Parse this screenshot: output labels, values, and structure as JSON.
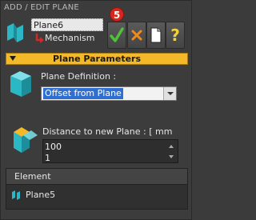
{
  "window": {
    "title": "ADD / EDIT PLANE"
  },
  "tree": {
    "selected_item": "Plane6",
    "child_item": "Mechanism"
  },
  "toolbar": {
    "badge": "5",
    "help_label": "?"
  },
  "section": {
    "title": "Plane Parameters"
  },
  "definition": {
    "label": "Plane Definition :",
    "selected_value": "Offset from Plane"
  },
  "distance": {
    "label": "Distance to new Plane : [ mm",
    "value_primary": "100",
    "value_secondary": "1"
  },
  "elements": {
    "header": "Element",
    "rows": [
      {
        "label": "Plane5"
      }
    ]
  },
  "colors": {
    "accent": "#f3b928",
    "ok_green": "#4fc23a",
    "cancel_orange": "#f08a1a",
    "plane_teal": "#2bb7c4",
    "badge_red": "#d9261c",
    "selection_blue": "#2f6fd1"
  }
}
